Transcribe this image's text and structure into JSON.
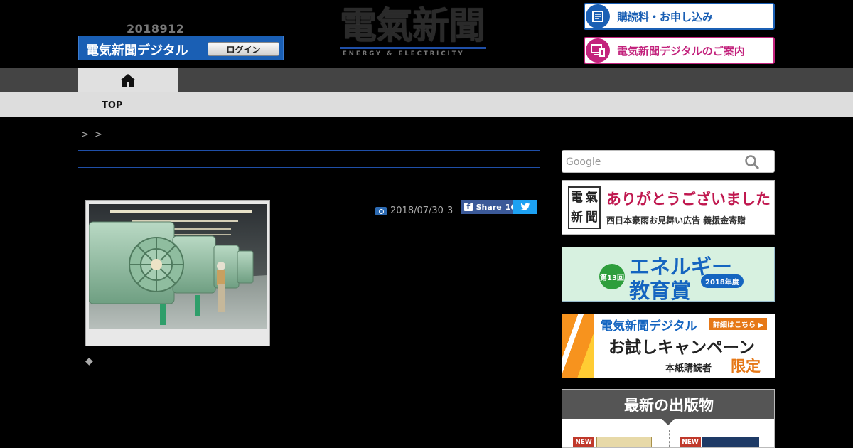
{
  "header": {
    "date": "2018912",
    "digital_title": "電気新聞デジタル",
    "login_label": "ログイン",
    "logo_text": "電氣新聞",
    "logo_subtitle": "ENERGY & ELECTRICITY",
    "subscribe_banner": "購読料・お申し込み",
    "digital_banner": "電気新聞デジタルのご案内"
  },
  "nav": {
    "home_icon": "home-icon",
    "top_label": "TOP"
  },
  "breadcrumb": "> >",
  "article": {
    "photo_caption": "",
    "date_meta": "2018/07/30",
    "meta_count": "3",
    "share_label": "Share",
    "share_count": "16",
    "lead": "◆",
    "body_lines": [
      "",
      "",
      "",
      "",
      ""
    ]
  },
  "sidebar": {
    "search_placeholder": "Google",
    "ad1_seal": [
      "電",
      "氣",
      "新",
      "聞"
    ],
    "ad1_main": "ありがとうございました",
    "ad1_sub": "西日本豪雨お見舞い広告 義援金寄贈",
    "ad2_badge": "第13回",
    "ad2_line1": "エネルギー",
    "ad2_line2": "教育賞",
    "ad2_year": "2018年度",
    "ad3_line1": "電気新聞デジタル",
    "ad3_tag": "詳細はこちら ▶",
    "ad3_line2": "お試しキャンペーン",
    "ad3_line3a": "本紙購読者",
    "ad3_line3b": "限定",
    "publications_title": "最新の出版物",
    "new_badge": "NEW"
  },
  "colors": {
    "brand_blue": "#1a5fb4",
    "brand_magenta": "#c3237d",
    "rule_blue": "#1f4fa8"
  }
}
